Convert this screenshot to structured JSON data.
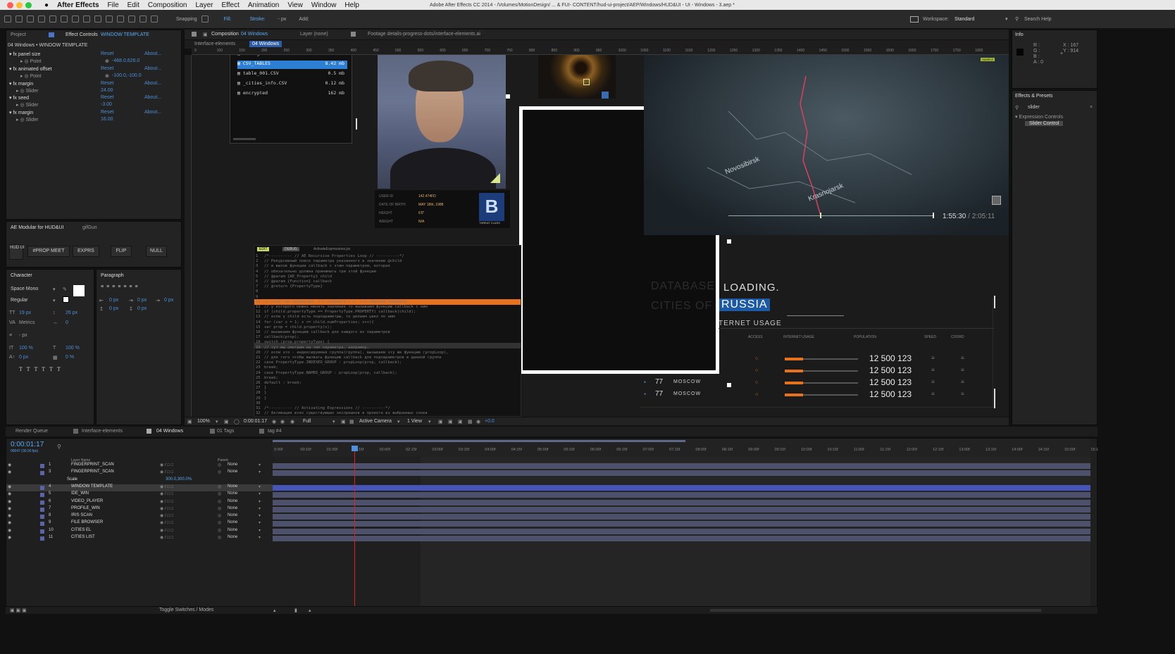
{
  "menubar": {
    "app": "After Effects",
    "items": [
      "File",
      "Edit",
      "Composition",
      "Layer",
      "Effect",
      "Animation",
      "View",
      "Window",
      "Help"
    ],
    "window_title": "Adobe After Effects CC 2014 - /Volumes/MotionDesign/ ... & FUI- CONTENT/hud-ui-project/AEP/Windows/HUD&UI - UI - Windows - 3.aep *"
  },
  "toolbar": {
    "snapping": "Snapping",
    "fill": "Fill:",
    "stroke": "Stroke:",
    "px": "- px",
    "add": "Add:",
    "workspace_label": "Workspace:",
    "workspace_value": "Standard",
    "search_help": "Search Help"
  },
  "left_panel": {
    "tab_project": "Project",
    "tab_effect_controls": "Effect Controls",
    "effect_target": "WINDOW TEMPLATE",
    "header": "04 Windows • WINDOW TEMPLATE",
    "effects": [
      {
        "name": "panel size",
        "reset": "Reset",
        "about": "About...",
        "sub": "Point",
        "value": "-468.0,626.0"
      },
      {
        "name": "animated offset",
        "reset": "Reset",
        "about": "About...",
        "sub": "Point",
        "value": "-100.0,-100.0"
      },
      {
        "name": "margin",
        "reset": "Reset",
        "about": "About...",
        "sub": "Slider",
        "value": "24.00"
      },
      {
        "name": "seed",
        "reset": "Reset",
        "about": "About...",
        "sub": "Slider",
        "value": "-3.00"
      },
      {
        "name": "margin",
        "reset": "Reset",
        "about": "About...",
        "sub": "Slider",
        "value": "16.00"
      }
    ],
    "modular_tab": "AE Modular for HUD&UI",
    "gifgun_tab": "gifGun",
    "buttons": [
      "#PROP MEET",
      "EXPRS",
      "FLIP",
      "NULL"
    ],
    "hud_label": "HUD UI"
  },
  "character": {
    "tab": "Character",
    "font": "Space Mono",
    "style": "Regular",
    "size": "19 px",
    "leading": "26 px",
    "kerning": "Metrics",
    "tracking": "0",
    "stroke": "- px",
    "vscale": "100 %",
    "hscale": "100 %",
    "baseline": "0 px",
    "tsume": "0 %"
  },
  "paragraph": {
    "tab": "Paragraph",
    "indent_left": "0 px",
    "indent_right": "0 px",
    "space_before": "0 px",
    "space_after": "0 px",
    "first_indent": "0 px"
  },
  "comp_tabs": {
    "composition_label": "Composition",
    "composition_name": "04 Windows",
    "layer": "Layer (none)",
    "footage": "Footage details-progress-dots/interface-elements.ai",
    "sub_tabs": [
      "Interface-elements",
      "04 Windows"
    ]
  },
  "ruler_labels": [
    "0",
    "100",
    "150",
    "200",
    "250",
    "300",
    "350",
    "400",
    "450",
    "500",
    "550",
    "600",
    "650",
    "700",
    "750",
    "800",
    "850",
    "900",
    "950",
    "1000",
    "1050",
    "1100",
    "1150",
    "1200",
    "1250",
    "1300",
    "1350",
    "1400",
    "1450",
    "1500",
    "1550",
    "1600",
    "1650",
    "1700",
    "1750",
    "1800"
  ],
  "file_browser": {
    "rows": [
      {
        "name": "footages",
        "size": "32 mb",
        "selected": false
      },
      {
        "name": "CSV_TABLES",
        "size": "8.42 mb",
        "selected": true
      },
      {
        "name": "table_001.CSV",
        "size": "0.5 mb",
        "selected": false
      },
      {
        "name": "_cities_info.CSV",
        "size": "0.12 mb",
        "selected": false
      },
      {
        "name": "encrypted",
        "size": "162 mb",
        "selected": false
      }
    ]
  },
  "profile": {
    "rows": [
      {
        "label": "USER ID",
        "value": "142.474FD"
      },
      {
        "label": "DATE OF BIRTH",
        "value": "MAY 18th, 1988"
      },
      {
        "label": "HEIGHT",
        "value": "6'0\""
      },
      {
        "label": "WEIGHT",
        "value": "N/A"
      }
    ],
    "badge": "B",
    "badge_caption": "THREAT CLASS"
  },
  "video_player": {
    "time_current": "1:55:30",
    "time_total": "/ 2:05:11",
    "map_labels": [
      "Novosibirsk",
      "Krasnojarsk"
    ],
    "sample": "SAMPLE"
  },
  "code_panel": {
    "tabs": [
      "EDIT",
      "DEBUG",
      "ActivateExpressions.jsx"
    ],
    "highlight_line": "function propLoop(child, callback) {",
    "lines": [
      "/*---------- // AE Recursive Properties Loop // ----------*/",
      "// Рекурсивный поиск параметра указанного в значении @child",
      "// и вызов функции callback с этим параметром, которая",
      "// обязательно должна принимать три этой функции",
      "// @param {AE_Property} child",
      "// @param {Function} callback",
      "// @return {PropertyType}",
      "",
      "function propLoop(child, callback) {",
      "  // если тип параметра, это параметр т.е. это обычный параметр,",
      "  // у которого можно менять значение то вызываем функцию callback с ним",
      "  if (child.propertyType == PropertyType.PROPERTY) callback(child);",
      "  // если у child есть подпараметры, то делаем цикл по ним",
      "  for (var x = 1; x <= child.numProperties; x++){",
      "    var prop = child.property(x);",
      "    // вызываем функцию callback для каждого из параметров",
      "    callback(prop);",
      "    switch (prop.propertyType) {",
      "      // тут мы смотрим на тип параметра, например,",
      "      // если это - индексируемая группа(группа), вызываем эту же функцию (propLoop),",
      "      // для того чтобы вызвать функцию callback для подпараметров в данной группе",
      "      case PropertyType.INDEXED_GROUP : propLoop(prop, callback);",
      "      break;",
      "      case PropertyType.NAMED_GROUP : propLoop(prop, callback);",
      "      break;",
      "      default : break;",
      "    }",
      "  }",
      "}",
      "",
      "/*---------- // Activating Expressions // ----------*/",
      "// Активация всех существующих экспрешнов в проекте из выбранных слоев"
    ]
  },
  "database": {
    "ghost_line1": "DATABASE",
    "loading": "LOADING.",
    "ghost_line2": "CITIES OF",
    "country": "RUSSIA",
    "subtitle": "TERNET USAGE",
    "columns": [
      "ACCESS",
      "INTERNET USAGE",
      "POPULATION",
      "SPEED",
      "COORD"
    ],
    "rows": [
      {
        "population": "12 500 123"
      },
      {
        "population": "12 500 123"
      },
      {
        "population": "12 500 123"
      },
      {
        "population": "12 500 123"
      }
    ],
    "cities": [
      {
        "code": "77",
        "name": "MOSCOW"
      },
      {
        "code": "77",
        "name": "MOSCOW"
      }
    ]
  },
  "viewer_bar": {
    "zoom": "100%",
    "timecode": "0:00:01:17",
    "quality": "Full",
    "camera": "Active Camera",
    "views": "1 View",
    "exposure": "+0.0"
  },
  "info_panel": {
    "tab": "Info",
    "r": "R :",
    "g": "G :",
    "b": "B :",
    "a": "A : 0",
    "x": "X : 167",
    "y": "Y : 914"
  },
  "effects_presets": {
    "tab": "Effects & Presets",
    "search": "slider",
    "group": "Expression Controls",
    "item": "Slider Control"
  },
  "timeline": {
    "tabs": [
      "Render Queue",
      "Interface-elements",
      "04 Windows",
      "01 Tags",
      "tag #4"
    ],
    "timecode": "0:00:01:17",
    "frames": "00047 (30.00 fps)",
    "layer_name_header": "Layer Name",
    "parent_header": "Parent",
    "time_labels": [
      "0:00f",
      "00:15f",
      "01:00f",
      "01:15f",
      "02:00f",
      "02:15f",
      "03:00f",
      "03:15f",
      "04:00f",
      "04:15f",
      "05:00f",
      "05:15f",
      "06:00f",
      "06:15f",
      "07:00f",
      "07:15f",
      "08:00f",
      "08:15f",
      "09:00f",
      "09:15f",
      "10:00f",
      "10:15f",
      "11:00f",
      "11:15f",
      "12:00f",
      "12:15f",
      "13:00f",
      "13:15f",
      "14:00f",
      "14:15f",
      "15:00f",
      "15:1"
    ],
    "layers": [
      {
        "num": "1",
        "name": "FINGERPRINT_SCAN",
        "parent": "None"
      },
      {
        "num": "3",
        "name": "FINGERPRINT_SCAN",
        "parent": "None"
      },
      {
        "num": "",
        "name": "Scale",
        "parent": "",
        "value": "300.0,300.0%"
      },
      {
        "num": "4",
        "name": "WINDOW TEMPLATE",
        "parent": "None"
      },
      {
        "num": "5",
        "name": "IDE_WIN",
        "parent": "None"
      },
      {
        "num": "6",
        "name": "VIDEO_PLAYER",
        "parent": "None"
      },
      {
        "num": "7",
        "name": "PROFILE_WIN",
        "parent": "None"
      },
      {
        "num": "8",
        "name": "IRIS SCAN",
        "parent": "None"
      },
      {
        "num": "9",
        "name": "FILE BROWSER",
        "parent": "None"
      },
      {
        "num": "10",
        "name": "CITIES EL",
        "parent": "None"
      },
      {
        "num": "11",
        "name": "CITIES LIST",
        "parent": "None"
      }
    ],
    "toggle": "Toggle Switches / Modes"
  },
  "colors": {
    "accent_blue": "#2d7fd3",
    "orange": "#e8721c",
    "bg": "#1b1b1b"
  }
}
